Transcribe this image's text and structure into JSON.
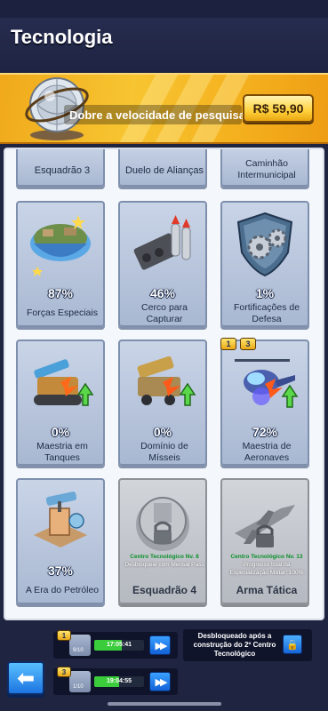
{
  "header": {
    "title": "Tecnologia"
  },
  "banner": {
    "text": "Dobre a velocidade de pesquisa.",
    "price": "R$ 59,90"
  },
  "top_row": [
    {
      "name": "Esquadrão 3"
    },
    {
      "name": "Duelo de Alianças"
    },
    {
      "name": "Caminhão Intermunicipal"
    }
  ],
  "cards": [
    {
      "name": "Forças Especiais",
      "percent": "87%",
      "icon": "floating-island-icon"
    },
    {
      "name": "Cerco para Capturar",
      "percent": "46%",
      "icon": "rocket-launcher-icon"
    },
    {
      "name": "Fortificações de Defesa",
      "percent": "1%",
      "icon": "gear-shield-icon"
    },
    {
      "name": "Maestria em Tanques",
      "percent": "0%",
      "icon": "tank-icon"
    },
    {
      "name": "Domínio de Mísseis",
      "percent": "0%",
      "icon": "missile-truck-icon"
    },
    {
      "name": "Maestria de Aeronaves",
      "percent": "72%",
      "icon": "helicopter-icon",
      "badges": [
        "1",
        "3"
      ]
    },
    {
      "name": "A Era do Petróleo",
      "percent": "37%",
      "icon": "oil-pump-icon"
    },
    {
      "name": "Esquadrão 4",
      "locked_title": "Centro Tecnológico Nv. 8",
      "locked_desc": "Desbloqueie com Mensal Pass",
      "icon": "locked-base-icon"
    },
    {
      "name": "Arma Tática",
      "locked_title": "Centro Tecnológico Nv. 13",
      "locked_desc": "Progresso total da Especialização Militar: 100%",
      "icon": "locked-jet-icon"
    }
  ],
  "queues": [
    {
      "badge": "1",
      "sub": "9/10",
      "time": "17:05:41",
      "progress": 0.55
    },
    {
      "badge": "3",
      "sub": "1/10",
      "time": "19:04:55",
      "progress": 0.5
    }
  ],
  "unlock_slot": {
    "text": "Desbloqueado após a construção do 2º Centro Tecnológico"
  },
  "colors": {
    "accent": "#f7c531",
    "progress": "#3bcc3b",
    "button": "#1d74e0"
  }
}
